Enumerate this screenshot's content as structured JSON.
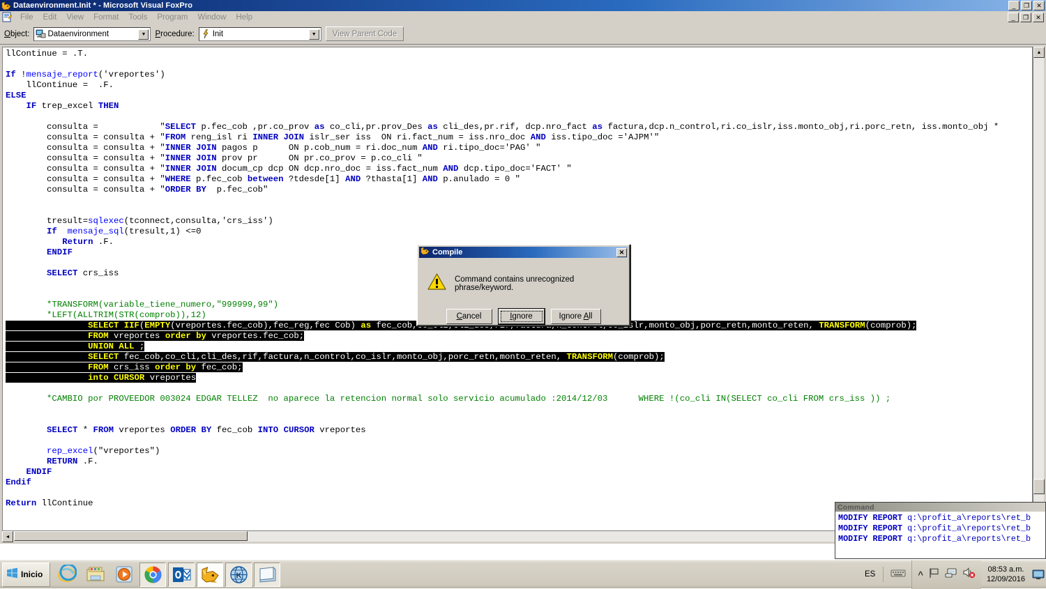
{
  "window": {
    "title": "Dataenvironment.Init * - Microsoft Visual FoxPro",
    "app_icon": "foxpro-fox-icon",
    "minimize_label": "_",
    "maximize_label": "❐",
    "close_label": "✕"
  },
  "menubar": {
    "system_icon": "document-icon",
    "items": [
      {
        "label": "File"
      },
      {
        "label": "Edit"
      },
      {
        "label": "View"
      },
      {
        "label": "Format"
      },
      {
        "label": "Tools"
      },
      {
        "label": "Program"
      },
      {
        "label": "Window"
      },
      {
        "label": "Help"
      }
    ],
    "doc_minimize": "_",
    "doc_restore": "❐",
    "doc_close": "✕"
  },
  "toolbar": {
    "object_label": "Object:",
    "object_value": "Dataenvironment",
    "object_icon": "dataenvironment-icon",
    "procedure_label": "Procedure:",
    "procedure_value": "Init",
    "procedure_icon": "lightning-icon",
    "view_parent_code_label": "View Parent Code",
    "dropdown_arrow": "▼"
  },
  "editor": {
    "scroll_up_arrow": "▲",
    "scroll_down_arrow": "▼",
    "scroll_left_arrow": "◄",
    "scroll_right_arrow": "►",
    "code": "llContinue = .T.\n\nIf !mensaje_report('vreportes')\n    llContinue =  .F.\nELSE\n    IF trep_excel THEN\n\n        consulta =            \"SELECT p.fec_cob ,pr.co_prov as co_cli,pr.prov_Des as cli_des,pr.rif, dcp.nro_fact as factura,dcp.n_control,ri.co_islr,iss.monto_obj,ri.porc_retn, iss.monto_obj * \n        consulta = consulta + \"FROM reng_isl ri INNER JOIN islr_ser iss  ON ri.fact_num = iss.nro_doc AND iss.tipo_doc ='AJPM'\"\n        consulta = consulta + \"INNER JOIN pagos p      ON p.cob_num = ri.doc_num AND ri.tipo_doc='PAG' \"\n        consulta = consulta + \"INNER JOIN prov pr      ON pr.co_prov = p.co_cli \"\n        consulta = consulta + \"INNER JOIN docum_cp dcp ON dcp.nro_doc = iss.fact_num AND dcp.tipo_doc='FACT' \"\n        consulta = consulta + \"WHERE p.fec_cob between ?tdesde[1] AND ?thasta[1] AND p.anulado = 0 \"\n        consulta = consulta + \"ORDER BY  p.fec_cob\"\n\n\n        tresult=sqlexec(tconnect,consulta,'crs_iss')\n        If  mensaje_sql(tresult,1) <=0\n           Return .F.\n        ENDIF\n\n        SELECT crs_iss\n\n\n        *TRANSFORM(variable_tiene_numero,\"999999,99\")\n        *LEFT(ALLTRIM(STR(comprob)),12)",
    "selected_lines": [
      "SELECT IIF(EMPTY(vreportes.fec_cob),fec_reg,fec Cob) as fec_cob,co_cli,cli_des,rif,factura,n_control,co_islr,monto_obj,porc_retn,monto_reten, TRANSFORM(comprob);",
      "FROM vreportes order by vreportes.fec_cob;",
      "UNION ALL ;",
      "SELECT fec_cob,co_cli,cli_des,rif,factura,n_control,co_islr,monto_obj,porc_retn,monto_reten, TRANSFORM(comprob);",
      "FROM crs_iss order by fec_cob;",
      "into CURSOR vreportes"
    ],
    "code_tail": "\n        *CAMBIO por PROVEEDOR 003024 EDGAR TELLEZ  no aparece la retencion normal solo servicio acumulado :2014/12/03      WHERE !(co_cli IN(SELECT co_cli FROM crs_iss )) ;\n\n\n        SELECT * FROM vreportes ORDER BY fec_cob INTO CURSOR vreportes\n\n        rep_excel(\"vreportes\")\n        RETURN .F.\n    ENDIF\nEndif\n\nReturn llContinue"
  },
  "compile_dialog": {
    "title": "Compile",
    "title_icon": "foxpro-fox-icon",
    "close_label": "✕",
    "warning_icon": "warning-triangle-icon",
    "message": "Command contains unrecognized phrase/keyword.",
    "buttons": [
      {
        "label": "Cancel",
        "accel": "C",
        "default": false
      },
      {
        "label": "Ignore",
        "accel": "I",
        "default": true
      },
      {
        "label": "Ignore All",
        "accel": "A",
        "default": false
      }
    ]
  },
  "command_window": {
    "title": "Command",
    "lines": [
      {
        "keyword": "MODIFY REPORT",
        "path": " q:\\profit_a\\reports\\ret_b"
      },
      {
        "keyword": "MODIFY REPORT",
        "path": " q:\\profit_a\\reports\\ret_b"
      },
      {
        "keyword": "MODIFY REPORT",
        "path": " q:\\profit_a\\reports\\ret_b"
      }
    ]
  },
  "taskbar": {
    "start_label": "Inicio",
    "start_icon": "windows-logo-icon",
    "quick_launch": [
      {
        "name": "internet-explorer-icon",
        "state": "normal"
      },
      {
        "name": "file-explorer-icon",
        "state": "normal"
      },
      {
        "name": "media-player-icon",
        "state": "normal"
      },
      {
        "name": "google-chrome-icon",
        "state": "pressed"
      },
      {
        "name": "outlook-icon",
        "state": "pressed"
      },
      {
        "name": "visual-foxpro-icon",
        "state": "active"
      },
      {
        "name": "k2b-globe-icon",
        "state": "pressed"
      },
      {
        "name": "notepad-icon",
        "state": "pressed"
      }
    ],
    "tray": {
      "language": "ES",
      "keyboard_icon": "keyboard-icon",
      "expand_icon": "chevron-up-icon",
      "flag_icon": "flag-icon",
      "network_icon": "network-icon",
      "volume_icon": "volume-muted-icon",
      "time": "08:53 a.m.",
      "date": "12/09/2016",
      "show_desktop_icon": "show-desktop-icon"
    }
  },
  "colors": {
    "titlebar_start": "#0a246a",
    "titlebar_end": "#8ab6e8",
    "chrome": "#d4d0c8",
    "keyword": "#0000c0",
    "comment": "#008000",
    "selection_bg": "#000000",
    "selection_keyword": "#ffff00"
  }
}
